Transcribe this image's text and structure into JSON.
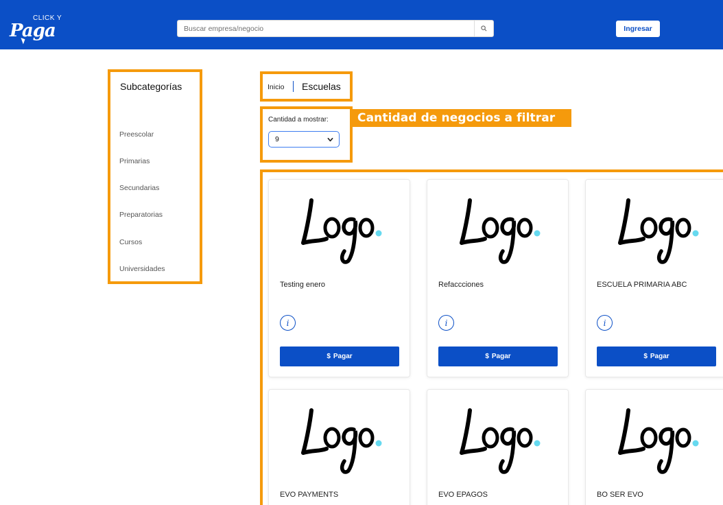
{
  "header": {
    "logo_top": "CLICK Y",
    "logo_main": "Paga",
    "search_placeholder": "Buscar empresa/negocio",
    "login_label": "Ingresar",
    "brand_color": "#0b4fc6"
  },
  "sidebar": {
    "title": "Subcategorías",
    "items": [
      {
        "label": "Preescolar"
      },
      {
        "label": "Primarias"
      },
      {
        "label": "Secundarias"
      },
      {
        "label": "Preparatorias"
      },
      {
        "label": "Cursos"
      },
      {
        "label": "Universidades"
      }
    ]
  },
  "breadcrumb": {
    "home": "Inicio",
    "current": "Escuelas"
  },
  "filter": {
    "label": "Cantidad a mostrar:",
    "selected": "9",
    "callout": "Cantidad de negocios a filtrar",
    "highlight_color": "#f59a0c"
  },
  "cards": [
    {
      "logo_text": "Logo",
      "name": "Testing enero",
      "info_icon": "info-icon",
      "pay_label": "Pagar",
      "pay_symbol": "$"
    },
    {
      "logo_text": "Logo",
      "name": "Refaccciones",
      "info_icon": "info-icon",
      "pay_label": "Pagar",
      "pay_symbol": "$"
    },
    {
      "logo_text": "Logo",
      "name": "ESCUELA PRIMARIA ABC",
      "info_icon": "info-icon",
      "pay_label": "Pagar",
      "pay_symbol": "$"
    },
    {
      "logo_text": "Logo",
      "name": "EVO PAYMENTS"
    },
    {
      "logo_text": "Logo",
      "name": "EVO EPAGOS"
    },
    {
      "logo_text": "Logo",
      "name": "BO SER EVO"
    }
  ]
}
